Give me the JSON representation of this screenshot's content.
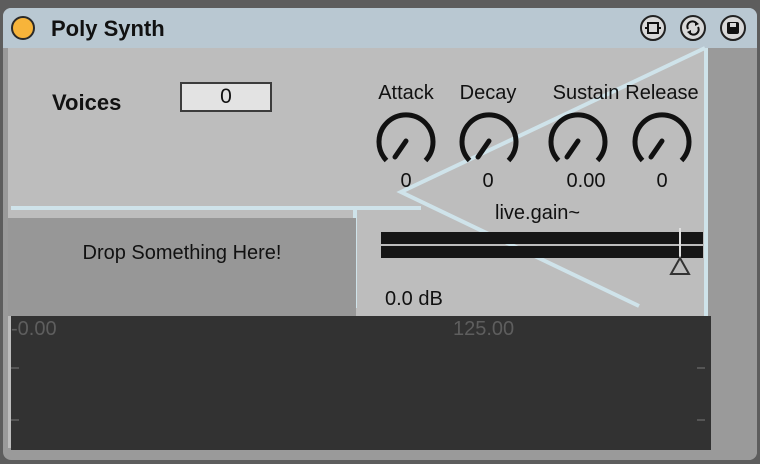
{
  "device": {
    "title": "Poly Synth",
    "icons": [
      "power-icon",
      "fold-icon",
      "swap-icon",
      "save-icon"
    ],
    "accent": "#f7b43a",
    "titlebar_color": "#b9c8d2"
  },
  "voices": {
    "label": "Voices",
    "value": "0"
  },
  "envelope": [
    {
      "name": "Attack",
      "value": "0"
    },
    {
      "name": "Decay",
      "value": "0"
    },
    {
      "name": "Sustain",
      "value": "0.00"
    },
    {
      "name": "Release",
      "value": "0"
    }
  ],
  "drop_zone": {
    "label": "Drop Something Here!"
  },
  "gain": {
    "title": "live.gain~",
    "readout": "0.0 dB"
  },
  "plot": {
    "start_label": "-0.00",
    "mid_label": "125.00"
  }
}
